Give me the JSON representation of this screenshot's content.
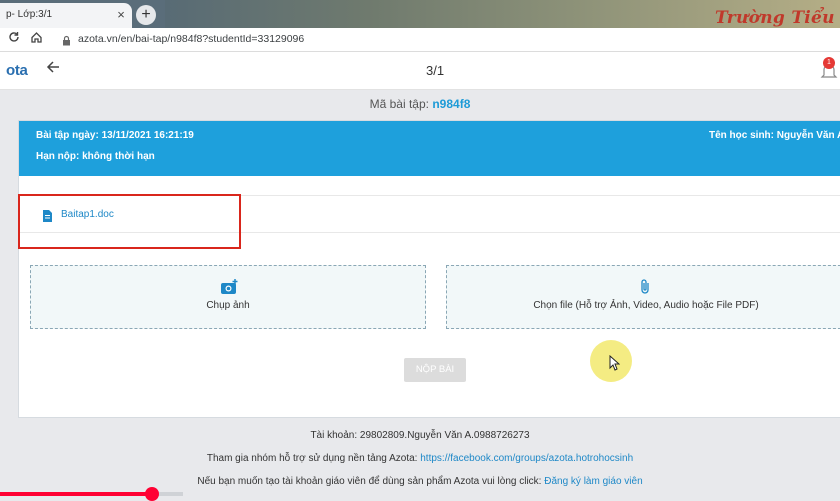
{
  "browser": {
    "tab_title": "p- Lớp:3/1",
    "tab_close": "×",
    "new_tab": "+",
    "url": "azota.vn/en/bai-tap/n984f8?studentId=33129096",
    "background_text": "Trường Tiểu học An Nhơ"
  },
  "header": {
    "logo": "ota",
    "page_count": "3/1",
    "notification_count": "1"
  },
  "exercise": {
    "code_label": "Mã bài tập:",
    "code_value": "n984f8"
  },
  "card": {
    "date_text": "Bài tập ngày: 13/11/2021 16:21:19",
    "deadline_text": "Hạn nộp: không thời hạn",
    "student_text": "Tên học sinh: Nguyễn Văn A",
    "file_name": "Baitap1.doc",
    "photo_label": "Chụp ảnh",
    "file_label": "Chọn file (Hỗ trợ Ảnh, Video, Audio hoặc File PDF)",
    "submit_label": "NỘP BÀI"
  },
  "footer": {
    "account": "Tài khoản: 29802809.Nguyễn Văn A.0988726273",
    "group_text": "Tham gia nhóm hỗ trợ sử dụng nền tảng Azota:",
    "group_link": "https://facebook.com/groups/azota.hotrohocsinh",
    "teacher_text": "Nếu bạn muốn tạo tài khoản giáo viên để dùng sản phẩm Azota vui lòng click:",
    "teacher_link": "Đăng ký làm giáo viên"
  },
  "video": {
    "progress": 0.83
  },
  "colors": {
    "accent": "#1ea0dc",
    "link": "#1e88c7",
    "highlight_box": "#d9261c"
  }
}
